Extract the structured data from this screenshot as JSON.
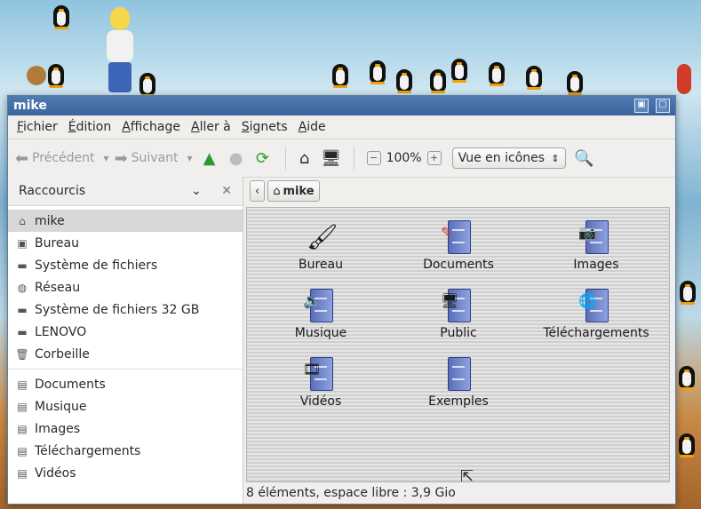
{
  "window": {
    "title": "mike"
  },
  "menu": [
    "Fichier",
    "Édition",
    "Affichage",
    "Aller à",
    "Signets",
    "Aide"
  ],
  "toolbar": {
    "back_label": "Précédent",
    "forward_label": "Suivant",
    "zoom_level": "100%",
    "view_mode": "Vue en icônes"
  },
  "sidebar": {
    "header": "Raccourcis",
    "items": [
      {
        "label": "mike",
        "icon": "home-icon"
      },
      {
        "label": "Bureau",
        "icon": "desktop-icon"
      },
      {
        "label": "Système de fichiers",
        "icon": "drive-icon"
      },
      {
        "label": "Réseau",
        "icon": "network-icon"
      },
      {
        "label": "Système de fichiers 32 GB",
        "icon": "drive-icon"
      },
      {
        "label": "LENOVO",
        "icon": "drive-icon"
      },
      {
        "label": "Corbeille",
        "icon": "trash-icon"
      }
    ],
    "bookmarks": [
      {
        "label": "Documents",
        "icon": "folder-icon"
      },
      {
        "label": "Musique",
        "icon": "folder-icon"
      },
      {
        "label": "Images",
        "icon": "folder-icon"
      },
      {
        "label": "Téléchargements",
        "icon": "folder-icon"
      },
      {
        "label": "Vidéos",
        "icon": "folder-icon"
      }
    ]
  },
  "path": {
    "current": "mike"
  },
  "files": [
    {
      "label": "Bureau",
      "icon": "desktop-folder-icon"
    },
    {
      "label": "Documents",
      "icon": "documents-folder-icon"
    },
    {
      "label": "Images",
      "icon": "images-folder-icon"
    },
    {
      "label": "Musique",
      "icon": "music-folder-icon"
    },
    {
      "label": "Public",
      "icon": "public-folder-icon"
    },
    {
      "label": "Téléchargements",
      "icon": "downloads-folder-icon"
    },
    {
      "label": "Vidéos",
      "icon": "videos-folder-icon"
    },
    {
      "label": "Exemples",
      "icon": "examples-folder-icon"
    }
  ],
  "status": "8 éléments, espace libre : 3,9 Gio"
}
